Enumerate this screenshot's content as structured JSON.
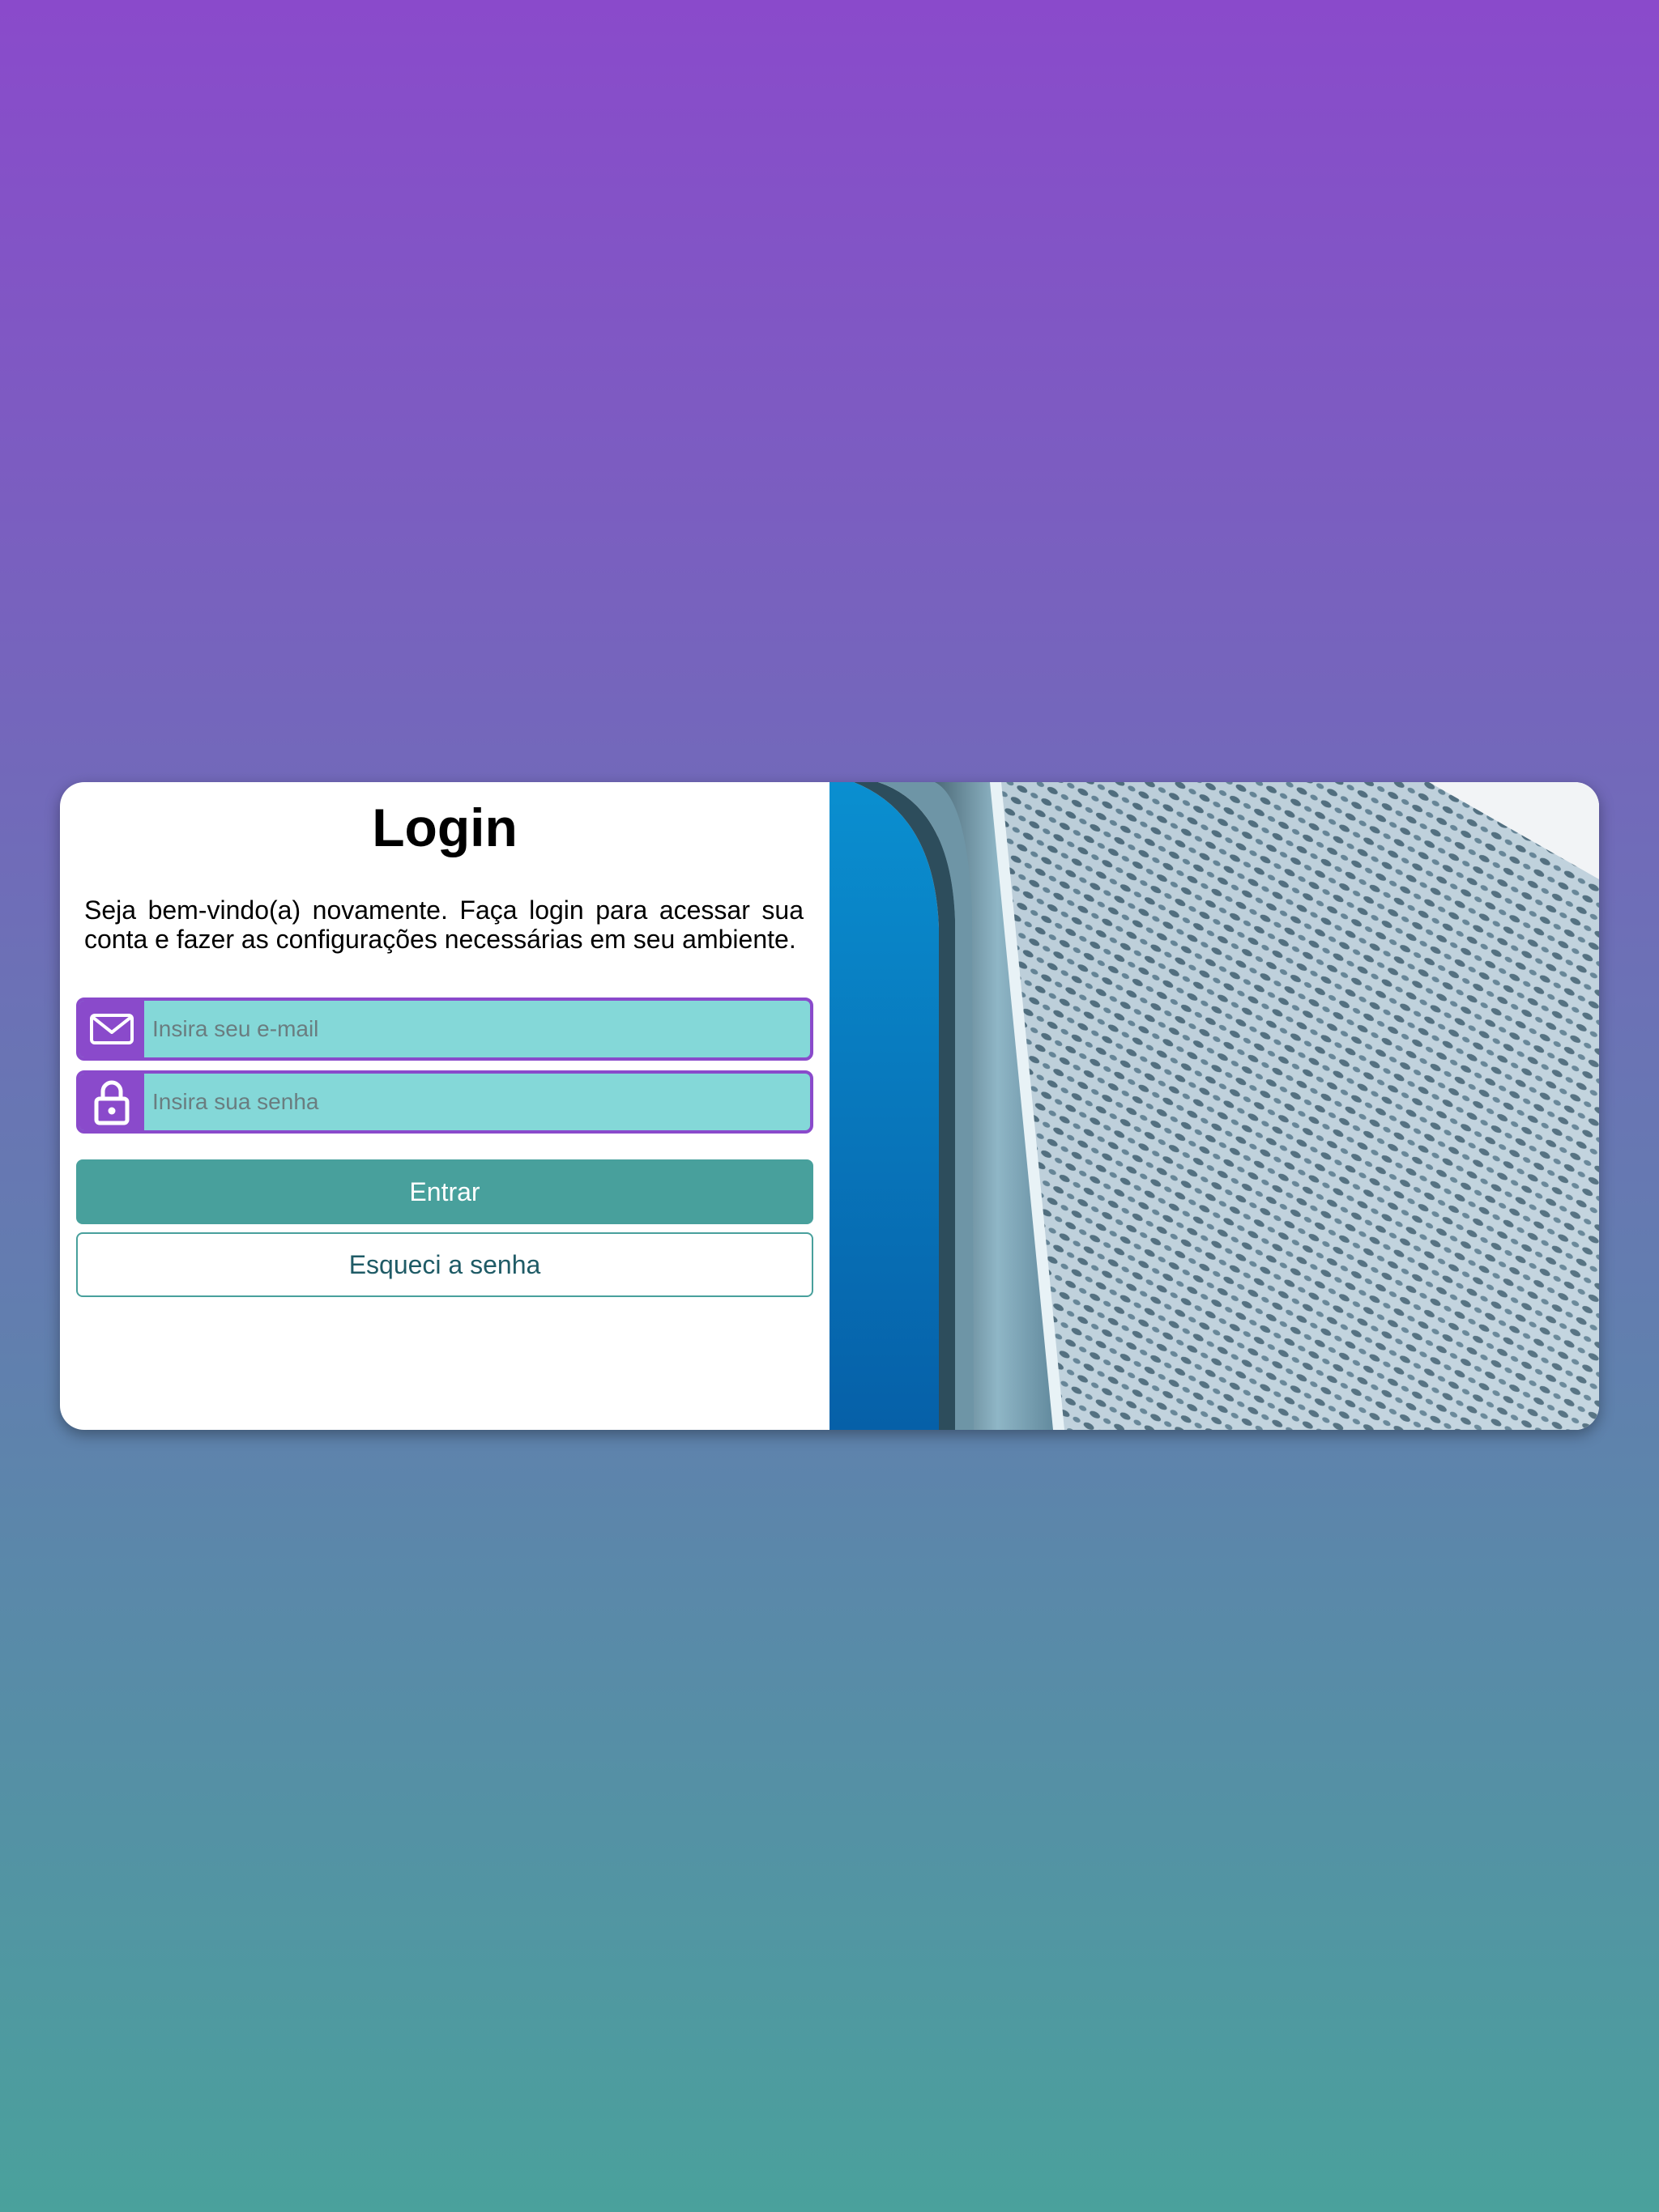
{
  "login": {
    "title": "Login",
    "welcome_text": "Seja bem-vindo(a) novamente. Faça login para acessar sua conta e fazer as configurações necessárias em seu ambiente.",
    "email": {
      "placeholder": "Insira seu e-mail",
      "icon": "mail-icon"
    },
    "password": {
      "placeholder": "Insira sua senha",
      "icon": "lock-icon"
    },
    "submit_label": "Entrar",
    "forgot_label": "Esqueci a senha"
  },
  "colors": {
    "background_top": "#8a4acb",
    "background_bottom": "#4aa19c",
    "accent_purple": "#8a4acb",
    "accent_teal": "#48a09c",
    "input_fill": "#84d8d8"
  }
}
